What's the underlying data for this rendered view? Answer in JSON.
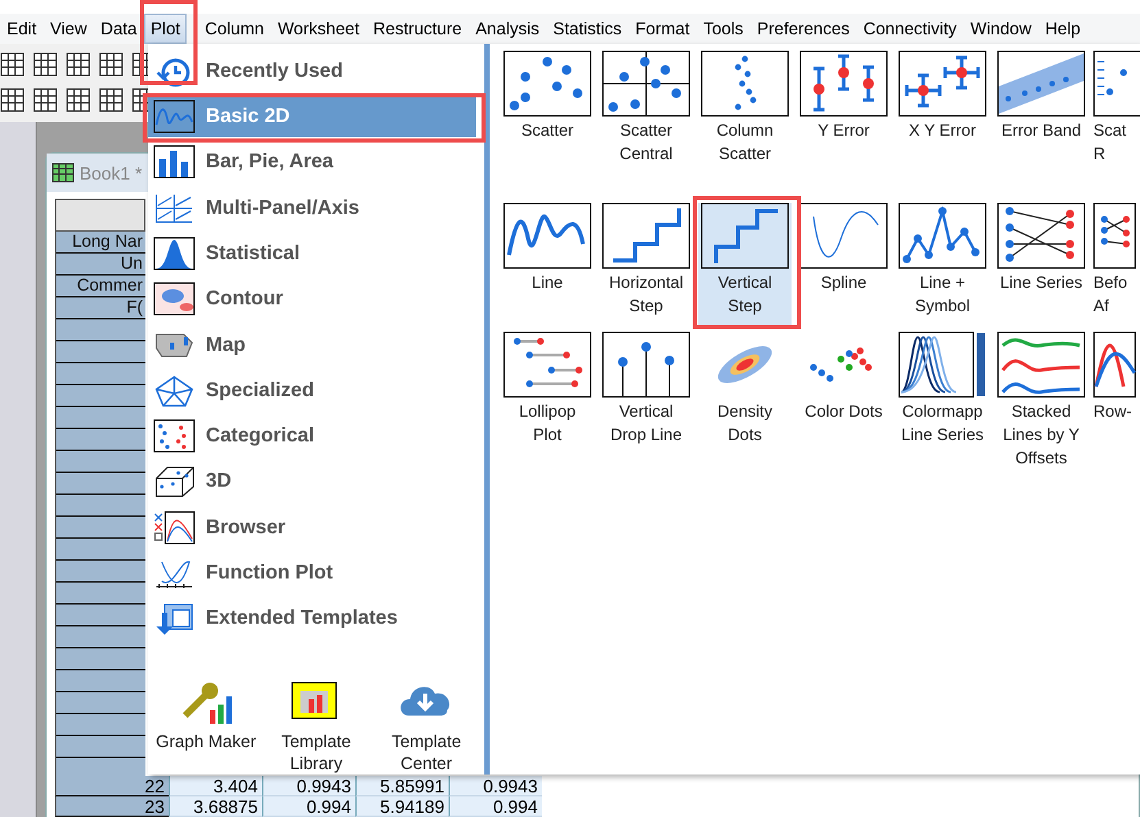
{
  "menubar": [
    {
      "label": "Edit",
      "selected": false
    },
    {
      "label": "View",
      "selected": false
    },
    {
      "label": "Data",
      "selected": false
    },
    {
      "label": "Plot",
      "selected": true
    },
    {
      "label": "Column",
      "selected": false
    },
    {
      "label": "Worksheet",
      "selected": false
    },
    {
      "label": "Restructure",
      "selected": false
    },
    {
      "label": "Analysis",
      "selected": false
    },
    {
      "label": "Statistics",
      "selected": false
    },
    {
      "label": "Format",
      "selected": false
    },
    {
      "label": "Tools",
      "selected": false
    },
    {
      "label": "Preferences",
      "selected": false
    },
    {
      "label": "Connectivity",
      "selected": false
    },
    {
      "label": "Window",
      "selected": false
    },
    {
      "label": "Help",
      "selected": false
    }
  ],
  "worksheet": {
    "title": "Book1 *",
    "header_labels": [
      "Long Nar",
      "Un",
      "Commer",
      "F("
    ],
    "rows": [
      {
        "index": "22",
        "cells": [
          "3.404",
          "0.9943",
          "5.85991",
          "0.9943"
        ]
      },
      {
        "index": "23",
        "cells": [
          "3.68875",
          "0.994",
          "5.94189",
          "0.994"
        ]
      }
    ]
  },
  "plot_menu": {
    "categories": [
      {
        "label": "Recently Used",
        "kind": "recent",
        "selected": false
      },
      {
        "label": "Basic 2D",
        "kind": "wave",
        "selected": true
      },
      {
        "label": "Bar, Pie, Area",
        "kind": "bars",
        "selected": false
      },
      {
        "label": "Multi-Panel/Axis",
        "kind": "panels",
        "selected": false
      },
      {
        "label": "Statistical",
        "kind": "histogram",
        "selected": false
      },
      {
        "label": "Contour",
        "kind": "contour",
        "selected": false
      },
      {
        "label": "Map",
        "kind": "map",
        "selected": false
      },
      {
        "label": "Specialized",
        "kind": "radar",
        "selected": false
      },
      {
        "label": "Categorical",
        "kind": "categorical",
        "selected": false
      },
      {
        "label": "3D",
        "kind": "cube",
        "selected": false
      },
      {
        "label": "Browser",
        "kind": "browser",
        "selected": false
      },
      {
        "label": "Function Plot",
        "kind": "function",
        "selected": false
      },
      {
        "label": "Extended Templates",
        "kind": "extended",
        "selected": false
      }
    ],
    "tools": [
      {
        "label": "Graph Maker",
        "kind": "wrench"
      },
      {
        "label": "Template\nLibrary",
        "kind": "library"
      },
      {
        "label": "Template\nCenter",
        "kind": "cloud"
      }
    ],
    "templates": [
      {
        "label": "Scatter",
        "kind": "scatter",
        "selected": false
      },
      {
        "label": "Scatter\nCentral",
        "kind": "central",
        "selected": false
      },
      {
        "label": "Column\nScatter",
        "kind": "colscatter",
        "selected": false
      },
      {
        "label": "Y Error",
        "kind": "yerror",
        "selected": false
      },
      {
        "label": "X Y Error",
        "kind": "xyerror",
        "selected": false
      },
      {
        "label": "Error Band",
        "kind": "band",
        "selected": false
      },
      {
        "label": "Scat\nR",
        "kind": "scatrug",
        "selected": false
      },
      {
        "label": "Line",
        "kind": "line",
        "selected": false
      },
      {
        "label": "Horizontal\nStep",
        "kind": "hstep",
        "selected": false
      },
      {
        "label": "Vertical\nStep",
        "kind": "vstep",
        "selected": true
      },
      {
        "label": "Spline",
        "kind": "spline",
        "selected": false
      },
      {
        "label": "Line +\nSymbol",
        "kind": "linesym",
        "selected": false
      },
      {
        "label": "Line Series",
        "kind": "lineseries",
        "selected": false
      },
      {
        "label": "Befo\nAf",
        "kind": "beforeafter",
        "selected": false
      },
      {
        "label": "Lollipop\nPlot",
        "kind": "lollipop",
        "selected": false
      },
      {
        "label": "Vertical\nDrop Line",
        "kind": "dropline",
        "selected": false
      },
      {
        "label": "Density\nDots",
        "kind": "density",
        "selected": false
      },
      {
        "label": "Color Dots",
        "kind": "colordots",
        "selected": false
      },
      {
        "label": "Colormapp\nLine Series",
        "kind": "colormap",
        "selected": false
      },
      {
        "label": "Stacked\nLines by Y\nOffsets",
        "kind": "stacked",
        "selected": false
      },
      {
        "label": "Row-",
        "kind": "rowwise",
        "selected": false
      }
    ]
  }
}
